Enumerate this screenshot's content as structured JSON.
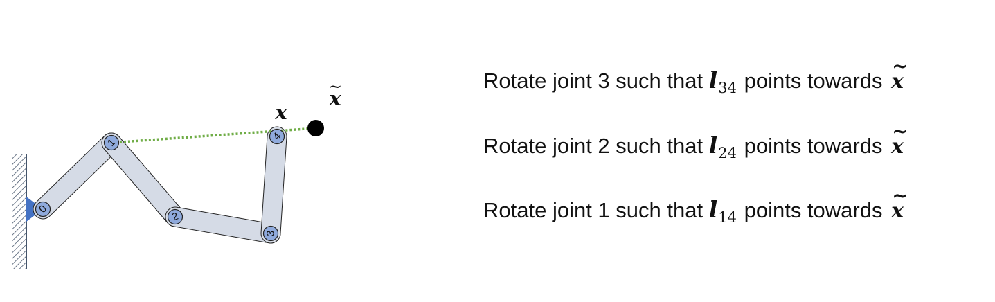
{
  "diagram": {
    "joint_labels": [
      "0",
      "1",
      "2",
      "3",
      "4"
    ],
    "end_effector_label": "x",
    "target_label": "x",
    "target_tilde": "~",
    "colors": {
      "link_fill": "#d5dbe6",
      "joint_fill": "#8faadc",
      "base_fill": "#4472c4",
      "hatch": "#44546a",
      "dotted_line": "#70ad47",
      "target": "#000000"
    }
  },
  "steps": [
    {
      "prefix": "Rotate joint 3 such that ",
      "l": "l",
      "sub": "34",
      "middle": " points towards ",
      "target": "x",
      "tilde": "~"
    },
    {
      "prefix": "Rotate joint 2 such that ",
      "l": "l",
      "sub": "24",
      "middle": " points towards ",
      "target": "x",
      "tilde": "~"
    },
    {
      "prefix": "Rotate joint 1 such that ",
      "l": "l",
      "sub": "14",
      "middle": " points towards ",
      "target": "x",
      "tilde": "~"
    }
  ]
}
